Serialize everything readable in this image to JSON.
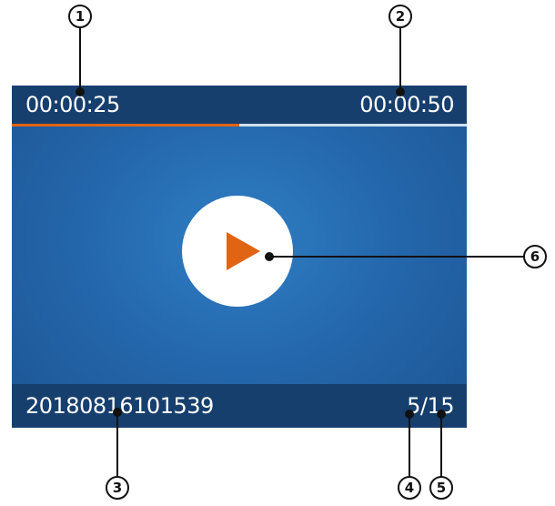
{
  "player": {
    "elapsed_time": "00:00:25",
    "total_time": "00:00:50",
    "progress": 0.5,
    "filename": "20180816101539",
    "current_index": "5",
    "separator": "/",
    "total_count": "15",
    "play_icon": "play-icon"
  },
  "callouts": [
    "1",
    "2",
    "3",
    "4",
    "5",
    "6"
  ],
  "colors": {
    "bar_background": "#173f6e",
    "screen_blue": "#2568ad",
    "progress_fill": "#e06414",
    "progress_track": "#cfe0f0",
    "play_triangle": "#e06414"
  }
}
